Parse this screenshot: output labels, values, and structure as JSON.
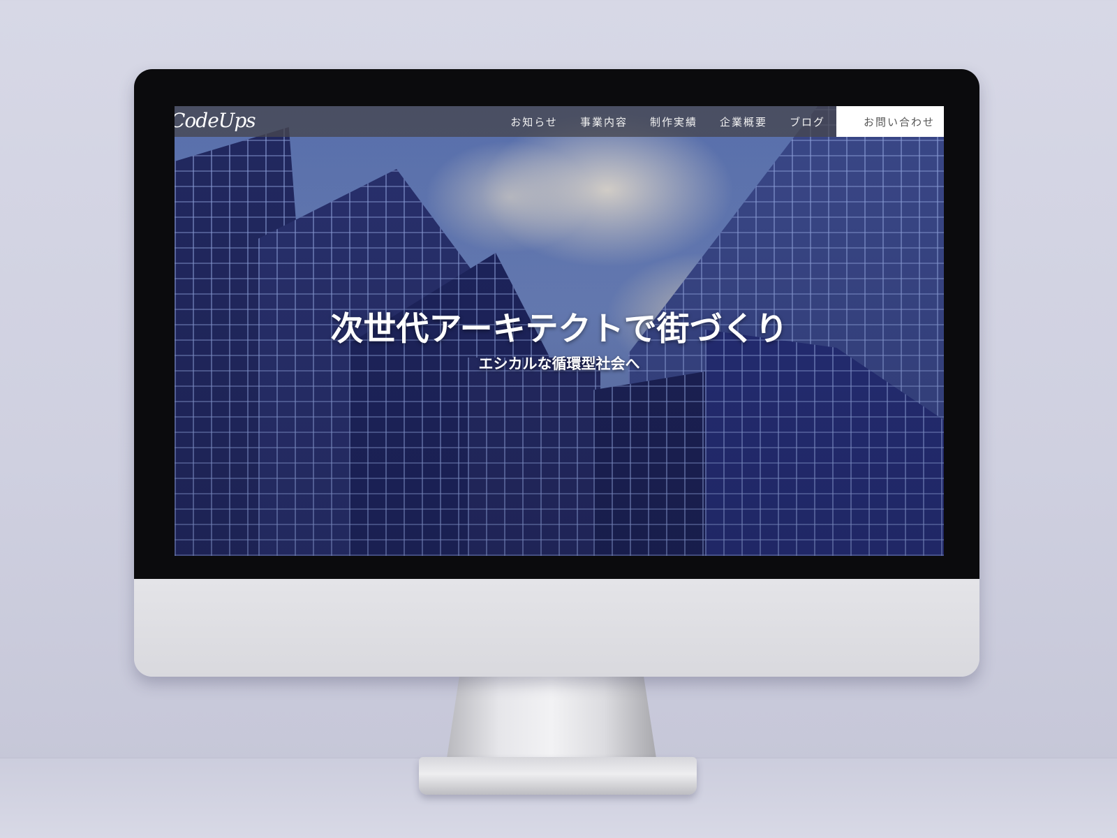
{
  "site": {
    "logo": "CodeUps",
    "nav": [
      "お知らせ",
      "事業内容",
      "制作実績",
      "企業概要",
      "ブログ"
    ],
    "contact_label": "お問い合わせ"
  },
  "hero": {
    "title": "次世代アーキテクトで街づくり",
    "subtitle": "エシカルな循環型社会へ"
  },
  "colors": {
    "header_bg": "#46464e",
    "contact_bg": "#ffffff",
    "hero_text": "#ffffff"
  }
}
